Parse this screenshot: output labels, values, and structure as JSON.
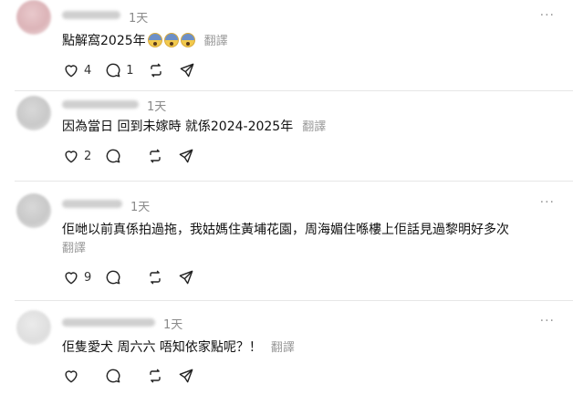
{
  "posts": [
    {
      "time": "1天",
      "text": "點解窩2025年",
      "emojis": [
        "fearful-face",
        "fearful-face",
        "fearful-face"
      ],
      "translate": "翻譯",
      "likes": "4",
      "replies": "1"
    },
    {
      "time": "1天",
      "text": "因為當日 回到未嫁時 就係2024-2025年",
      "translate": "翻譯",
      "likes": "2",
      "replies": ""
    },
    {
      "time": "1天",
      "text": "佢哋以前真係拍過拖，我姑媽住黃埔花園，周海媚住喺樓上佢話見過黎明好多次",
      "translate": "翻譯",
      "likes": "9",
      "replies": ""
    },
    {
      "time": "1天",
      "text": "佢隻愛犬 周六六 唔知依家點呢？！",
      "translate": "翻譯",
      "likes": "",
      "replies": ""
    }
  ],
  "more_label": "···",
  "colors": {
    "text": "#111111",
    "muted": "#8a8a8a",
    "divider": "#e6e6e6"
  }
}
